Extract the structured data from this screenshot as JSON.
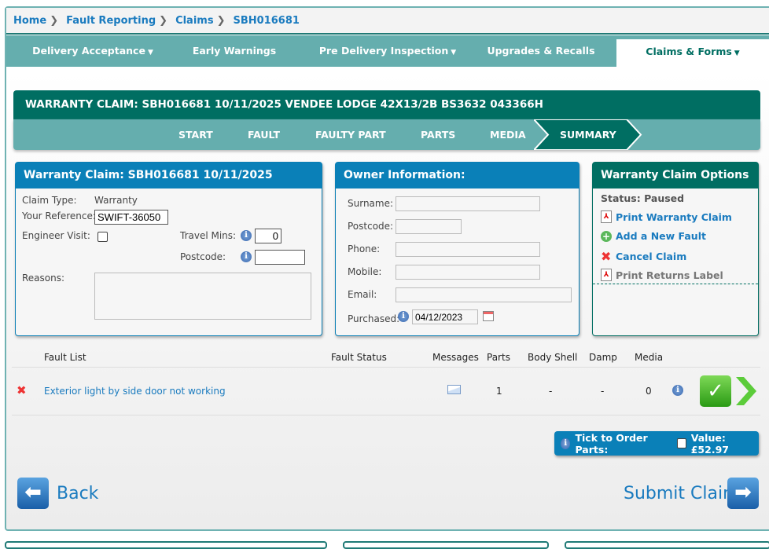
{
  "breadcrumb": [
    "Home",
    "Fault Reporting",
    "Claims",
    "SBH016681"
  ],
  "nav": {
    "items": [
      "Delivery Acceptance",
      "Early Warnings",
      "Pre Delivery Inspection",
      "Upgrades & Recalls",
      "Claims & Forms"
    ],
    "active": "Claims & Forms"
  },
  "title": "WARRANTY CLAIM: SBH016681 10/11/2025 VENDEE LODGE 42X13/2B BS3632 043366H",
  "steps": [
    "START",
    "FAULT",
    "FAULTY PART",
    "PARTS",
    "MEDIA",
    "SUMMARY"
  ],
  "active_step": "SUMMARY",
  "claim_panel": {
    "title": "Warranty Claim: SBH016681 10/11/2025",
    "claim_type_label": "Claim Type:",
    "claim_type": "Warranty",
    "reference_label": "Your Reference:",
    "reference": "SWIFT-36050",
    "engineer_label": "Engineer Visit:",
    "travel_label": "Travel Mins:",
    "travel": "0",
    "postcode_label": "Postcode:",
    "postcode": "",
    "reasons_label": "Reasons:",
    "reasons": ""
  },
  "owner_panel": {
    "title": "Owner Information:",
    "surname_label": "Surname:",
    "postcode_label": "Postcode:",
    "phone_label": "Phone:",
    "mobile_label": "Mobile:",
    "email_label": "Email:",
    "purchased_label": "Purchased:",
    "purchased": "04/12/2023"
  },
  "options_panel": {
    "title": "Warranty Claim Options",
    "status": "Status: Paused",
    "print_claim": "Print Warranty Claim",
    "add_fault": "Add a New Fault",
    "cancel": "Cancel Claim",
    "print_returns": "Print Returns Label"
  },
  "fault_list": {
    "headers": [
      "Fault List",
      "Fault Status",
      "Messages",
      "Parts",
      "Body Shell",
      "Damp",
      "Media"
    ],
    "rows": [
      {
        "fault": "Exterior light by side door not working",
        "status": "",
        "parts": "1",
        "body_shell": "-",
        "damp": "-",
        "media": "0"
      }
    ]
  },
  "order": {
    "label": "Tick to Order Parts:",
    "value": "Value: £52.97"
  },
  "back_label": "Back",
  "submit_label": "Submit Claim",
  "colors": {
    "teal": "#65aeae",
    "dark_green": "#006e62",
    "blue": "#0a80b8",
    "link": "#1a7bbf"
  }
}
